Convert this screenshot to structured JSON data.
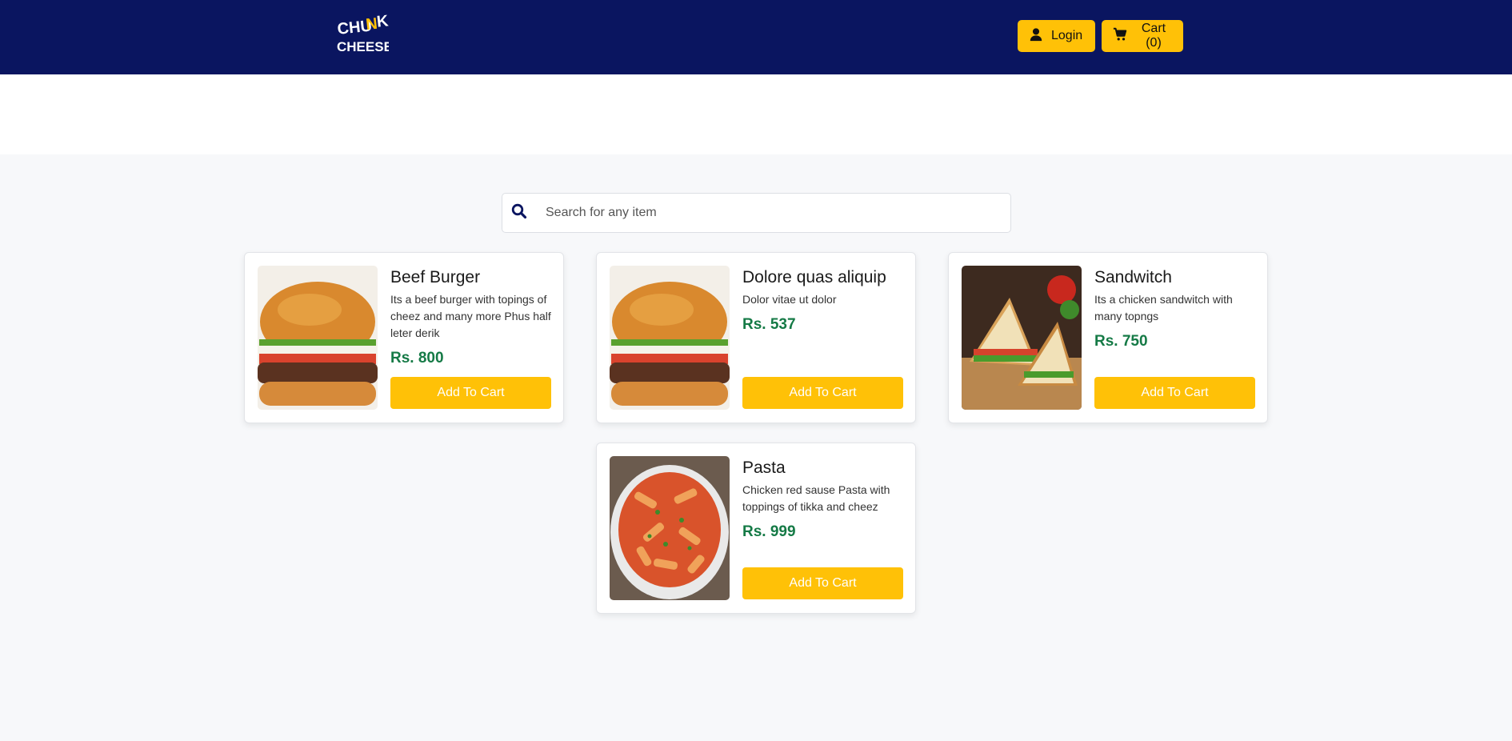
{
  "navbar": {
    "background": "#0a1560",
    "logo_text": "CHUNK CHEESE",
    "login_label": "Login",
    "cart_label": "Cart (0)",
    "login_icon": "user-icon",
    "cart_icon": "cart-icon",
    "button_color": "#ffc107"
  },
  "search": {
    "placeholder": "Search for any item",
    "value": "",
    "icon": "search-icon"
  },
  "products": [
    {
      "title": "Beef Burger",
      "description": "Its a beef burger with topings of cheez and many more Phus half leter derik",
      "price": "Rs. 800",
      "button": "Add To Cart",
      "image": "burger"
    },
    {
      "title": "Dolore quas aliquip",
      "description": "Dolor vitae ut dolor",
      "price": "Rs. 537",
      "button": "Add To Cart",
      "image": "burger"
    },
    {
      "title": "Sandwitch",
      "description": "Its a chicken sandwitch with many topngs",
      "price": "Rs. 750",
      "button": "Add To Cart",
      "image": "sandwich"
    },
    {
      "title": "Pasta",
      "description": "Chicken red sause Pasta with toppings of tikka and cheez",
      "price": "Rs. 999",
      "button": "Add To Cart",
      "image": "pasta"
    }
  ],
  "colors": {
    "price": "#157a46",
    "accent": "#ffc107",
    "page_bg": "#f7f8fa"
  }
}
